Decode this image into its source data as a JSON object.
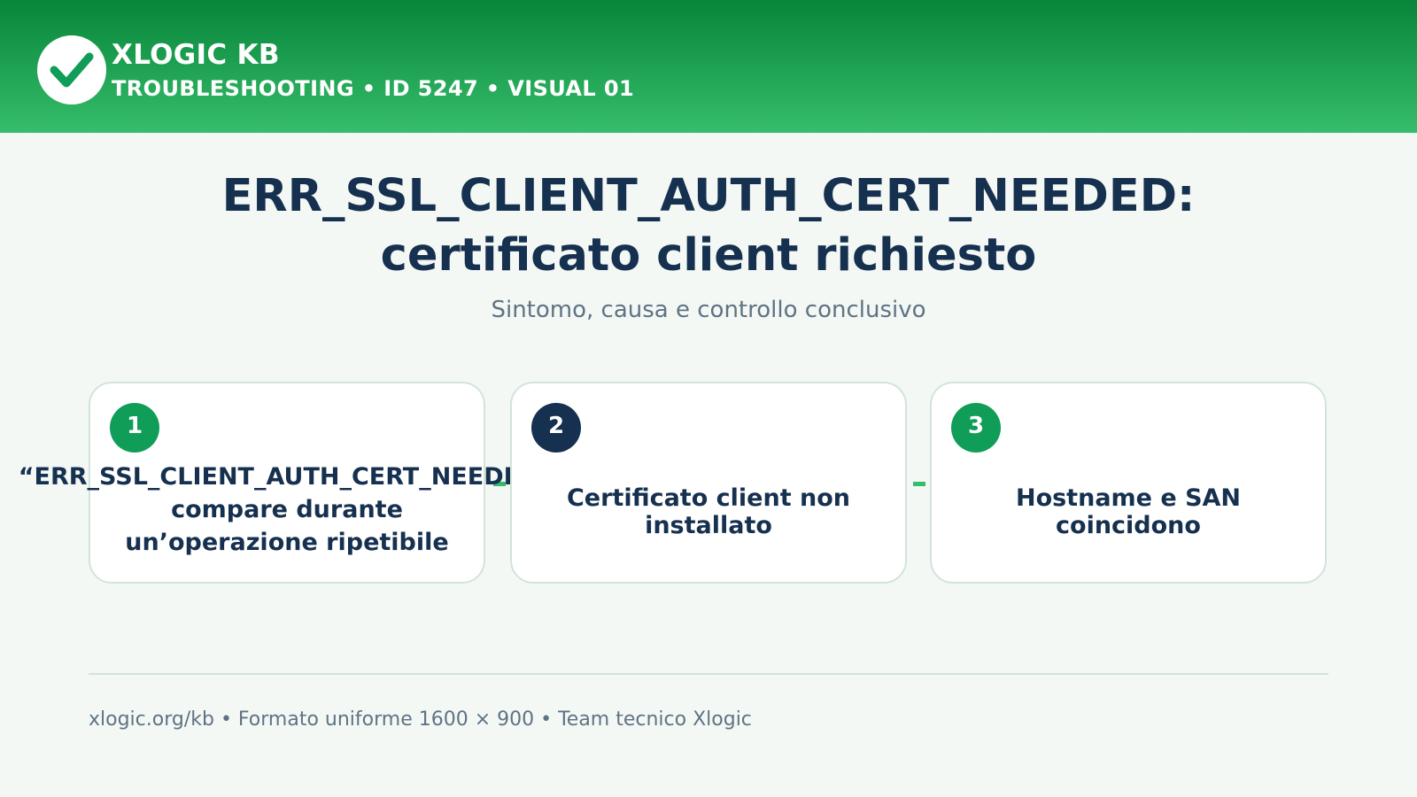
{
  "brand": {
    "name": "XLOGIC KB",
    "meta": "TROUBLESHOOTING • ID 5247 • VISUAL 01",
    "logo_icon": "check-circle-icon"
  },
  "title": {
    "line1": "ERR_SSL_CLIENT_AUTH_CERT_NEEDED:",
    "line2": "certificato client richiesto"
  },
  "subtitle": "Sintomo, causa e controllo conclusivo",
  "steps": [
    {
      "number": "1",
      "lines": [
        "“ERR_SSL_CLIENT_AUTH_CERT_NEEDED”",
        "compare durante",
        "un’operazione ripetibile"
      ]
    },
    {
      "number": "2",
      "lines": [
        "Certificato client non",
        "installato"
      ]
    },
    {
      "number": "3",
      "lines": [
        "Hostname e SAN",
        "coincidono"
      ]
    }
  ],
  "footer": "xlogic.org/kb • Formato uniforme 1600 × 900 • Team tecnico Xlogic",
  "colors": {
    "header_dark": "#07853a",
    "header_light": "#36bd6b",
    "accent_green": "#0f9d58",
    "navy": "#16304f",
    "muted_text": "#5f7384",
    "card_border": "#d2e4da",
    "background": "#f4f8f5"
  }
}
